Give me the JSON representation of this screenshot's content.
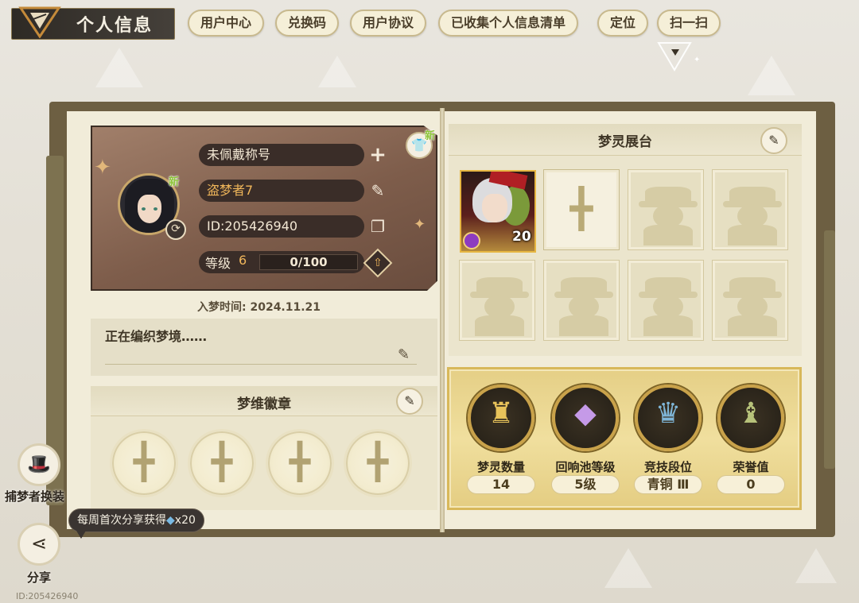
{
  "header": {
    "title": "个人信息",
    "buttons": [
      "用户中心",
      "兑换码",
      "用户协议",
      "已收集个人信息清单",
      "定位",
      "扫一扫"
    ]
  },
  "profile": {
    "new_badge": "新",
    "title_slot": "未佩戴称号",
    "nickname": "盗梦者7",
    "id_text": "ID:205426940",
    "level_label": "等级",
    "level": "6",
    "exp_text": "0/100",
    "exp_fraction": 0,
    "join_date": "入梦时间: 2024.11.21",
    "motto": "正在编织梦境……"
  },
  "badges": {
    "title": "梦维徽章",
    "slot_count": 4
  },
  "sidebar": {
    "outfit_label": "捕梦者换装",
    "share_label": "分享",
    "share_tip": "每周首次分享获得",
    "share_reward": "x20"
  },
  "footer": {
    "id_text": "ID:205426940"
  },
  "showcase": {
    "title": "梦灵展台",
    "featured_level": "20"
  },
  "stats": [
    {
      "label": "梦灵数量",
      "value": "14",
      "icon": "spirit-card-icon"
    },
    {
      "label": "回响池等级",
      "value": "5级",
      "icon": "crystal-icon"
    },
    {
      "label": "竞技段位",
      "value": "青铜 Ⅲ",
      "icon": "trophy-icon"
    },
    {
      "label": "荣誉值",
      "value": "0",
      "icon": "chess-piece-icon"
    }
  ],
  "colors": {
    "accent_gold": "#c9a24a",
    "level_orange": "#f0b65a",
    "new_green": "#8dc43a",
    "profile_card": "#7e5d4b"
  }
}
